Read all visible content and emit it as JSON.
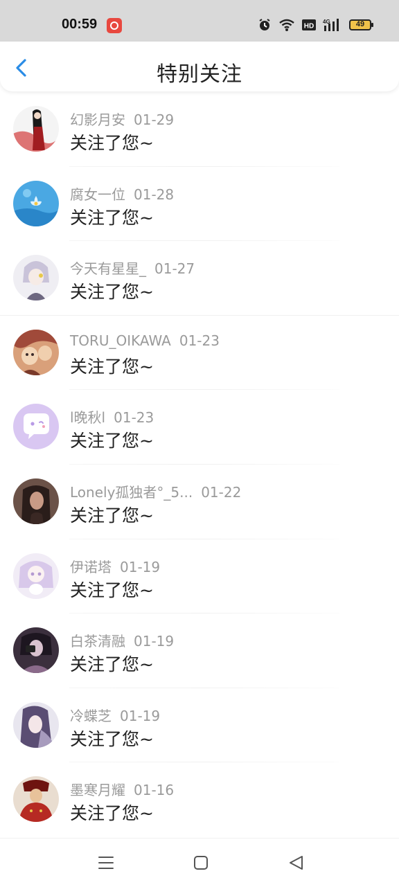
{
  "status_bar": {
    "time": "00:59",
    "battery": "49",
    "icons": [
      "alarm-icon",
      "wifi-icon",
      "hd-icon",
      "4g-signal-icon",
      "battery-icon"
    ]
  },
  "header": {
    "back_icon": "chevron-left-icon",
    "title": "特别关注",
    "accent_color": "#2a8ce6"
  },
  "items": [
    {
      "name": "幻影月安",
      "date": "01-29",
      "message": "关注了您~",
      "avatar_colors": [
        "#f4f4f4",
        "#c4282b",
        "#1a1a1a"
      ]
    },
    {
      "name": "腐女一位",
      "date": "01-28",
      "message": "关注了您~",
      "avatar_colors": [
        "#5fb8ea",
        "#2a86c9",
        "#dff3ff"
      ]
    },
    {
      "name": "今天有星星_",
      "date": "01-27",
      "message": "关注了您~",
      "avatar_colors": [
        "#efeef3",
        "#c9c3d9",
        "#6d6780"
      ]
    },
    {
      "name": "TORU_OIKAWA",
      "date": "01-23",
      "message": "关注了您~",
      "avatar_colors": [
        "#d9a07a",
        "#a04a3a",
        "#f3d6b8"
      ]
    },
    {
      "name": "l晚秋l",
      "date": "01-23",
      "message": "关注了您~",
      "avatar_colors": [
        "#d9c7f2",
        "#b89ae6",
        "#ffffff"
      ]
    },
    {
      "name": "Lonely孤独者°_5...",
      "date": "01-22",
      "message": "关注了您~",
      "avatar_colors": [
        "#6b5248",
        "#2a1d1a",
        "#c89a85"
      ]
    },
    {
      "name": "伊诺塔",
      "date": "01-19",
      "message": "关注了您~",
      "avatar_colors": [
        "#f1ecf6",
        "#d8c8ea",
        "#b49ad1"
      ]
    },
    {
      "name": "白茶清融",
      "date": "01-19",
      "message": "关注了您~",
      "avatar_colors": [
        "#3b2f3d",
        "#8a6a8a",
        "#d9c2cf"
      ]
    },
    {
      "name": "冷蝶芝",
      "date": "01-19",
      "message": "关注了您~",
      "avatar_colors": [
        "#e8e6ef",
        "#a79bbd",
        "#5a4d73"
      ]
    },
    {
      "name": "墨寒月耀",
      "date": "01-16",
      "message": "关注了您~",
      "avatar_colors": [
        "#b62a23",
        "#6e1410",
        "#e8c29a"
      ]
    }
  ],
  "system_nav": {
    "menu_icon": "menu-icon",
    "home_icon": "home-square-icon",
    "back_icon": "back-triangle-icon"
  }
}
